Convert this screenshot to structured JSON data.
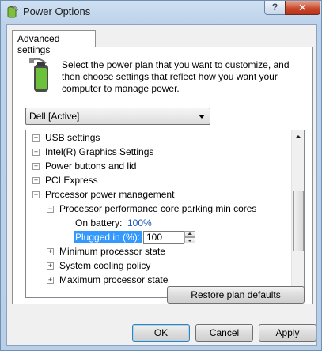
{
  "window": {
    "title": "Power Options",
    "help_label": "?",
    "close_label": "✕"
  },
  "tab": {
    "label": "Advanced settings"
  },
  "description": "Select the power plan that you want to customize, and then choose settings that reflect how you want your computer to manage power.",
  "plan_select": {
    "value": "Dell [Active]"
  },
  "tree": {
    "items": [
      {
        "label": "USB settings",
        "expander": "+"
      },
      {
        "label": "Intel(R) Graphics Settings",
        "expander": "+"
      },
      {
        "label": "Power buttons and lid",
        "expander": "+"
      },
      {
        "label": "PCI Express",
        "expander": "+"
      },
      {
        "label": "Processor power management",
        "expander": "−"
      },
      {
        "label": "Processor performance core parking min cores",
        "expander": "−"
      },
      {
        "label": "On battery:",
        "value": "100%"
      },
      {
        "label": "Plugged in (%):",
        "value": "100"
      },
      {
        "label": "Minimum processor state",
        "expander": "+"
      },
      {
        "label": "System cooling policy",
        "expander": "+"
      },
      {
        "label": "Maximum processor state",
        "expander": "+"
      }
    ]
  },
  "buttons": {
    "restore": "Restore plan defaults",
    "ok": "OK",
    "cancel": "Cancel",
    "apply": "Apply"
  },
  "colors": {
    "accent": "#3399ff",
    "link_blue": "#1f58b5"
  }
}
